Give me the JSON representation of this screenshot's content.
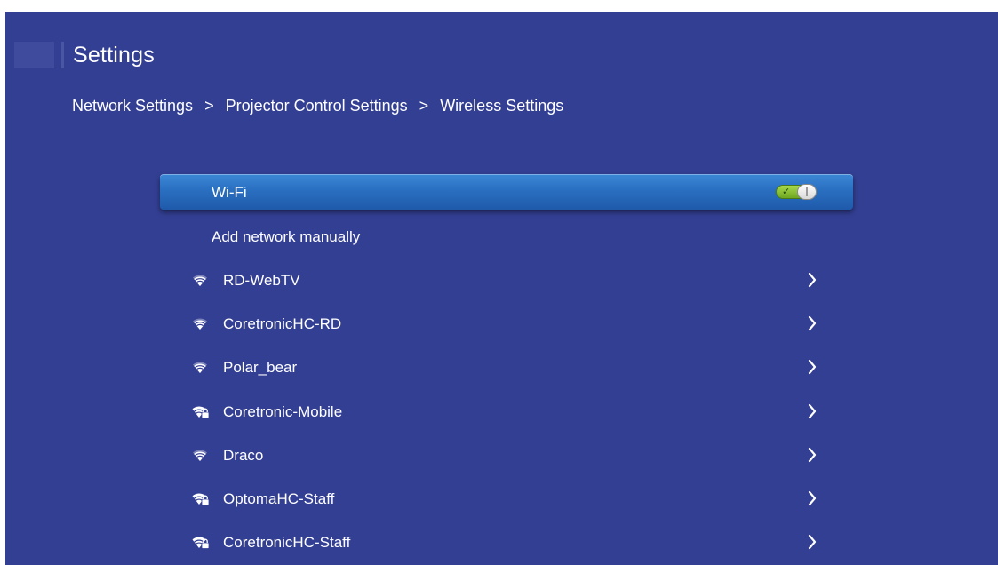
{
  "header": {
    "title": "Settings"
  },
  "breadcrumb": {
    "items": [
      "Network Settings",
      "Projector Control Settings",
      "Wireless Settings"
    ],
    "separator": ">"
  },
  "wifi": {
    "label": "Wi-Fi",
    "enabled": true,
    "toggle_check": "✓"
  },
  "add_network": {
    "label": "Add network manually"
  },
  "networks": [
    {
      "name": "RD-WebTV",
      "secured": false
    },
    {
      "name": "CoretronicHC-RD",
      "secured": false
    },
    {
      "name": "Polar_bear",
      "secured": false
    },
    {
      "name": "Coretronic-Mobile",
      "secured": true
    },
    {
      "name": "Draco",
      "secured": false
    },
    {
      "name": "OptomaHC-Staff",
      "secured": true
    },
    {
      "name": "CoretronicHC-Staff",
      "secured": true
    }
  ],
  "colors": {
    "background": "#333f93",
    "highlight": "#2a6fc1",
    "toggle_on": "#8cc63f",
    "text": "#ffffff"
  },
  "icons": {
    "open_network": "wifi-icon",
    "secured_network": "wifi-lock-icon",
    "row_action": "chevron-right-icon"
  }
}
